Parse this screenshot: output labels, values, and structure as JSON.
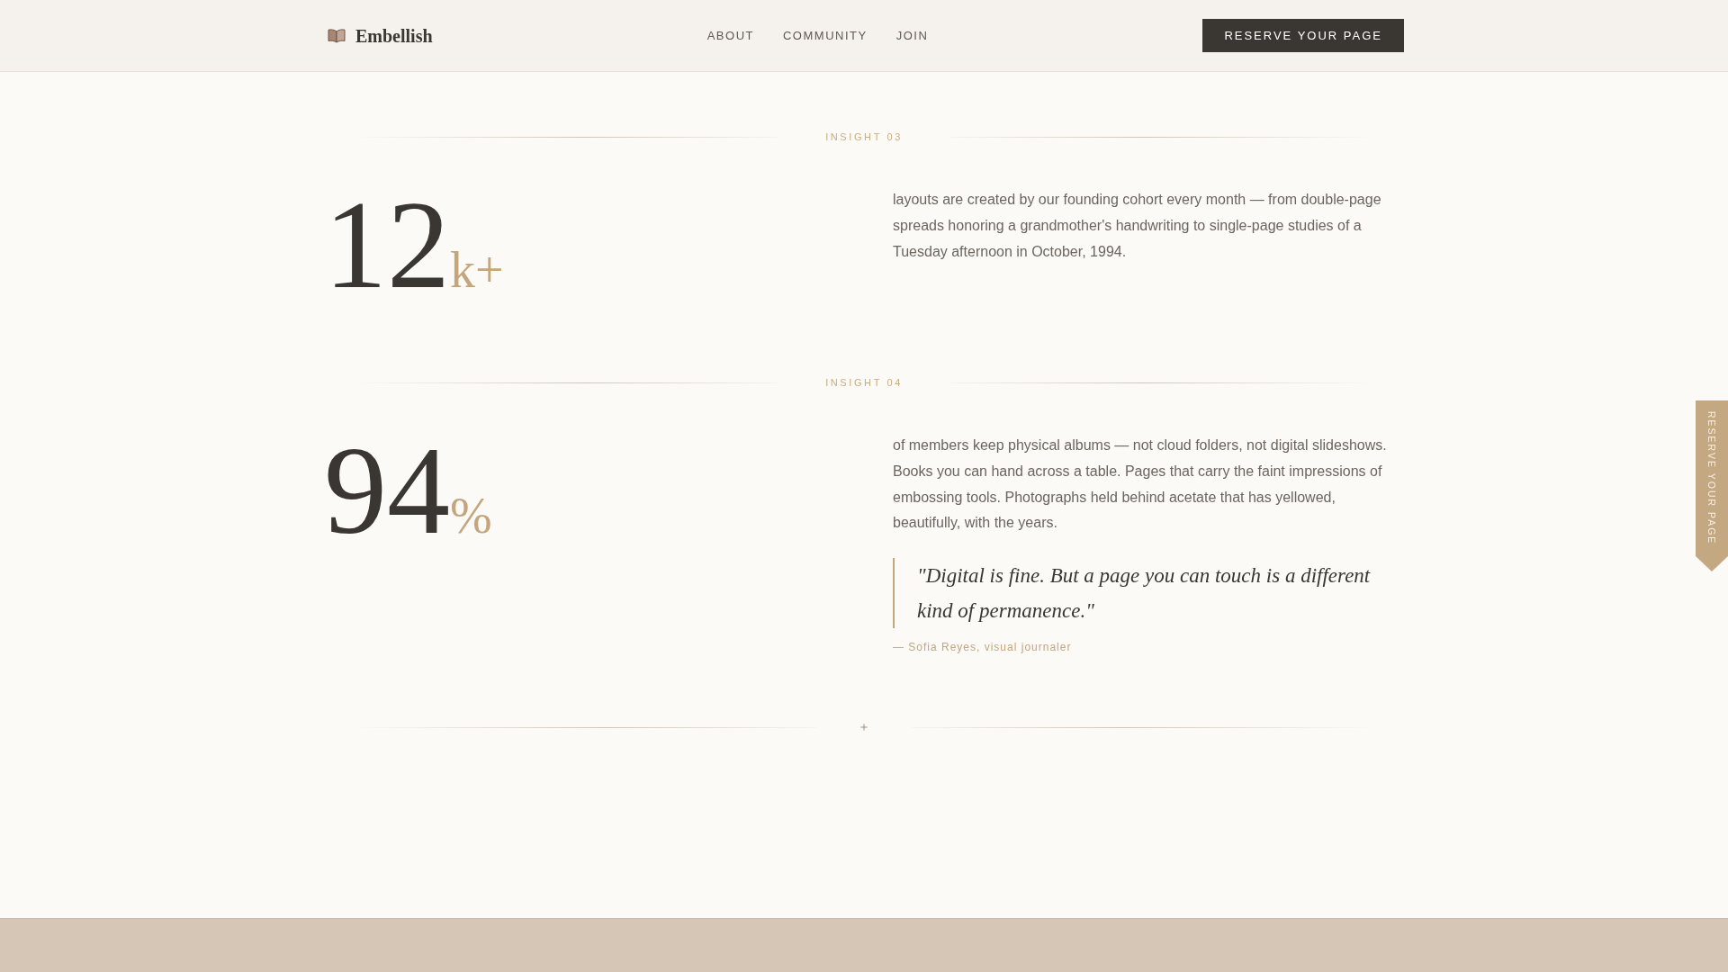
{
  "header": {
    "brand": "Embellish",
    "nav": [
      "ABOUT",
      "COMMUNITY",
      "JOIN"
    ],
    "cta": "RESERVE YOUR PAGE"
  },
  "insights": [
    {
      "label": "INSIGHT 03",
      "number": "12",
      "suffix": "k+",
      "text": "layouts are created by our founding cohort every month — from double-page spreads honoring a grandmother's handwriting to single-page studies of a Tuesday afternoon in October, 1994."
    },
    {
      "label": "INSIGHT 04",
      "number": "94",
      "suffix": "%",
      "text": "of members keep physical albums — not cloud folders, not digital slideshows. Books you can hand across a table. Pages that carry the faint impressions of embossing tools. Photographs held behind acetate that has yellowed, beautifully, with the years.",
      "quote": {
        "text": "\"Digital is fine. But a page you can touch is a different kind of permanence.\"",
        "attribution": "— Sofia Reyes, visual journaler"
      }
    }
  ],
  "side_tab": {
    "label": "RESERVE YOUR PAGE"
  }
}
